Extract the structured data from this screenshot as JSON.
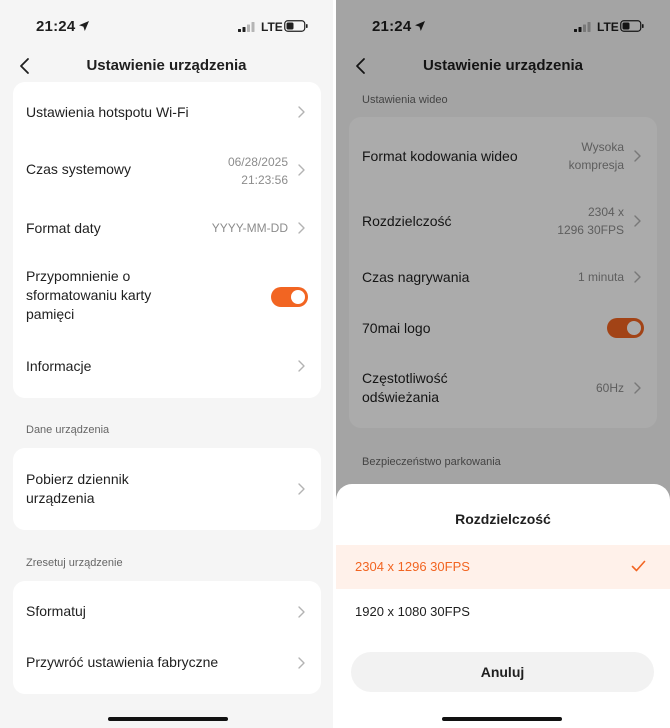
{
  "status_bar": {
    "time": "21:24",
    "network": "LTE"
  },
  "left": {
    "title": "Ustawienie urządzenia",
    "items": [
      {
        "label": "Ustawienia hotspotu Wi-Fi"
      },
      {
        "label": "Czas systemowy",
        "value_line1": "06/28/2025",
        "value_line2": "21:23:56"
      },
      {
        "label": "Format daty",
        "value": "YYYY-MM-DD"
      },
      {
        "label_line1": "Przypomnienie o",
        "label_line2": "sformatowaniu karty",
        "label_line3": "pamięci",
        "toggle_on": true
      },
      {
        "label": "Informacje"
      }
    ],
    "section_device_data": "Dane urządzenia",
    "log": {
      "label_line1": "Pobierz dziennik",
      "label_line2": "urządzenia"
    },
    "section_reset": "Zresetuj urządzenie",
    "reset_items": [
      {
        "label": "Sformatuj"
      },
      {
        "label": "Przywróć ustawienia fabryczne"
      }
    ]
  },
  "right": {
    "title": "Ustawienie urządzenia",
    "section_video": "Ustawienia wideo",
    "items": [
      {
        "label": "Format kodowania wideo",
        "value_line1": "Wysoka",
        "value_line2": "kompresja"
      },
      {
        "label": "Rozdzielczość",
        "value_line1": "2304 x",
        "value_line2": "1296 30FPS"
      },
      {
        "label": "Czas nagrywania",
        "value": "1 minuta"
      },
      {
        "label": "70mai logo",
        "toggle_on": true
      },
      {
        "label_line1": "Częstotliwość",
        "label_line2": "odświeżania",
        "value": "60Hz"
      }
    ],
    "section_parking": "Bezpieczeństwo parkowania",
    "sheet": {
      "title": "Rozdzielczość",
      "options": [
        {
          "label": "2304 x 1296 30FPS",
          "selected": true
        },
        {
          "label": "1920 x 1080 30FPS",
          "selected": false
        }
      ],
      "cancel_label": "Anuluj"
    }
  },
  "colors": {
    "accent": "#f26522",
    "selected_bg": "#fff1ea",
    "background": "#f5f5f5",
    "card": "#ffffff"
  }
}
